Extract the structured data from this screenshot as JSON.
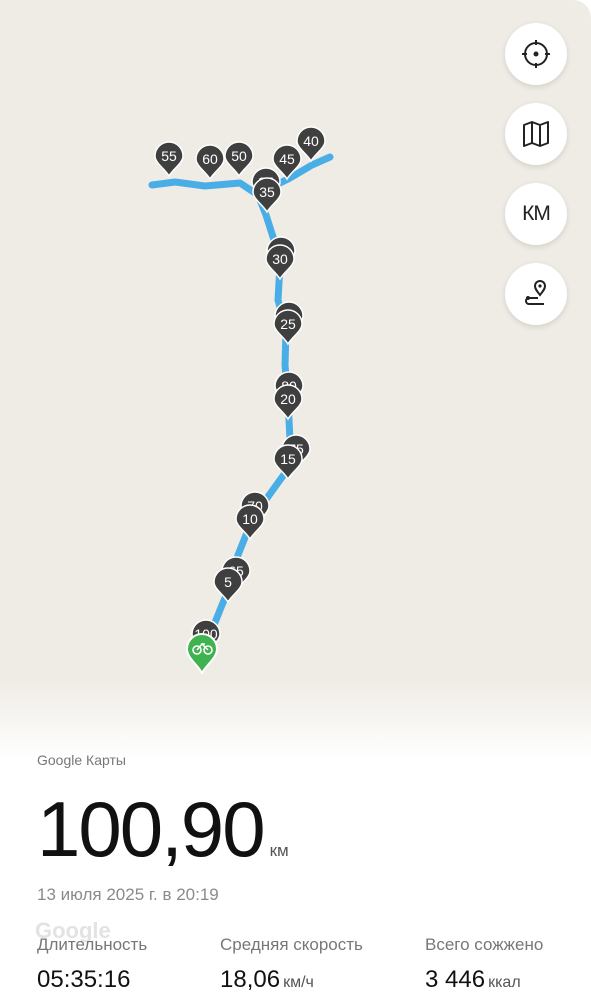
{
  "map": {
    "markers": [
      "55",
      "60",
      "50",
      "45",
      "40",
      "35",
      "30",
      "25",
      "20",
      "15",
      "10",
      "5"
    ],
    "hidden_markers": [
      "95",
      "90",
      "85",
      "80",
      "75",
      "70",
      "65",
      "100"
    ],
    "route_color": "#4aaee6",
    "marker_color": "#3f3f3f",
    "start_color": "#3fb34f",
    "controls": [
      "locate-icon",
      "map-layers-icon",
      "unit-toggle",
      "route-pin-icon"
    ],
    "unit_toggle_label": "КМ"
  },
  "summary": {
    "source": "Google Карты",
    "distance": "100,90",
    "distance_unit": "км",
    "date": "13 июля 2025 г. в 20:19",
    "watermark": "Google"
  },
  "stats": {
    "duration": {
      "label": "Длительность",
      "value": "05:35:16"
    },
    "avg_speed": {
      "label": "Средняя скорость",
      "value": "18,06",
      "unit": "км/ч"
    },
    "calories": {
      "label": "Всего сожжено",
      "value": "3 446",
      "unit": "ккал"
    }
  }
}
